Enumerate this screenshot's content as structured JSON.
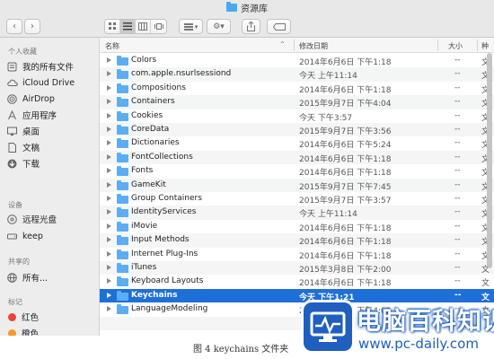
{
  "window": {
    "title": "资源库"
  },
  "toolbar": {
    "back_glyph": "‹",
    "forward_glyph": "›",
    "arrange_glyph": "▾",
    "action_glyph": "⚙▾"
  },
  "sidebar": {
    "sections": [
      {
        "heading": "个人收藏",
        "items": [
          {
            "label": "我的所有文件",
            "icon": "all-files-icon"
          },
          {
            "label": "iCloud Drive",
            "icon": "cloud-icon"
          },
          {
            "label": "AirDrop",
            "icon": "airdrop-icon"
          },
          {
            "label": "应用程序",
            "icon": "applications-icon"
          },
          {
            "label": "桌面",
            "icon": "desktop-icon"
          },
          {
            "label": "文稿",
            "icon": "documents-icon"
          },
          {
            "label": "下载",
            "icon": "downloads-icon"
          }
        ]
      },
      {
        "heading": "设备",
        "items": [
          {
            "label": "远程光盘",
            "icon": "disc-icon"
          },
          {
            "label": "keep",
            "icon": "disk-icon"
          }
        ]
      },
      {
        "heading": "共享的",
        "items": [
          {
            "label": "所有...",
            "icon": "network-icon"
          }
        ]
      },
      {
        "heading": "标记",
        "items": [
          {
            "label": "红色",
            "icon": "red-tag-icon",
            "color": "#f0423b"
          },
          {
            "label": "橙色",
            "icon": "orange-tag-icon",
            "color": "#f59a2a"
          }
        ]
      }
    ]
  },
  "list": {
    "headers": {
      "name": "名称",
      "date": "修改日期",
      "size": "大小",
      "kind": "种"
    },
    "rows": [
      {
        "name": "Colors",
        "date": "2014年6月6日 下午1:18",
        "size": "--",
        "kind": "文"
      },
      {
        "name": "com.apple.nsurlsessiond",
        "date": "今天 上午11:14",
        "size": "--",
        "kind": "文"
      },
      {
        "name": "Compositions",
        "date": "2014年6月6日 下午1:18",
        "size": "--",
        "kind": "文"
      },
      {
        "name": "Containers",
        "date": "2015年9月7日 下午4:04",
        "size": "--",
        "kind": "文"
      },
      {
        "name": "Cookies",
        "date": "今天 下午3:57",
        "size": "--",
        "kind": "文"
      },
      {
        "name": "CoreData",
        "date": "2015年9月7日 下午3:56",
        "size": "--",
        "kind": "文"
      },
      {
        "name": "Dictionaries",
        "date": "2014年6月6日 下午5:24",
        "size": "--",
        "kind": "文"
      },
      {
        "name": "FontCollections",
        "date": "2014年6月6日 下午1:18",
        "size": "--",
        "kind": "文"
      },
      {
        "name": "Fonts",
        "date": "2014年6月6日 下午1:18",
        "size": "--",
        "kind": "文"
      },
      {
        "name": "GameKit",
        "date": "2015年9月7日 下午7:45",
        "size": "--",
        "kind": "文"
      },
      {
        "name": "Group Containers",
        "date": "2015年9月7日 下午3:57",
        "size": "--",
        "kind": "文"
      },
      {
        "name": "IdentityServices",
        "date": "今天 上午11:14",
        "size": "--",
        "kind": "文"
      },
      {
        "name": "iMovie",
        "date": "2014年6月6日 下午1:18",
        "size": "--",
        "kind": "文"
      },
      {
        "name": "Input Methods",
        "date": "2014年6月6日 下午1:18",
        "size": "--",
        "kind": "文"
      },
      {
        "name": "Internet Plug-Ins",
        "date": "2014年6月6日 下午1:18",
        "size": "--",
        "kind": "文"
      },
      {
        "name": "iTunes",
        "date": "2015年3月8日 下午2:00",
        "size": "--",
        "kind": "文"
      },
      {
        "name": "Keyboard Layouts",
        "date": "2014年6月6日 下午1:18",
        "size": "--",
        "kind": "文"
      },
      {
        "name": "Keychains",
        "date": "今天 下午1:21",
        "size": "--",
        "kind": "文",
        "selected": true
      },
      {
        "name": "LanguageModeling",
        "date": "2015年9月7日 下午4:03",
        "size": "--",
        "kind": "文"
      },
      {
        "name": "",
        "date": "",
        "size": "",
        "kind": ""
      }
    ]
  },
  "caption": {
    "text": "图 4  keychains 文件夹"
  },
  "watermark": {
    "title": "电脑百科知识",
    "url": "www.pc-daily.com"
  }
}
